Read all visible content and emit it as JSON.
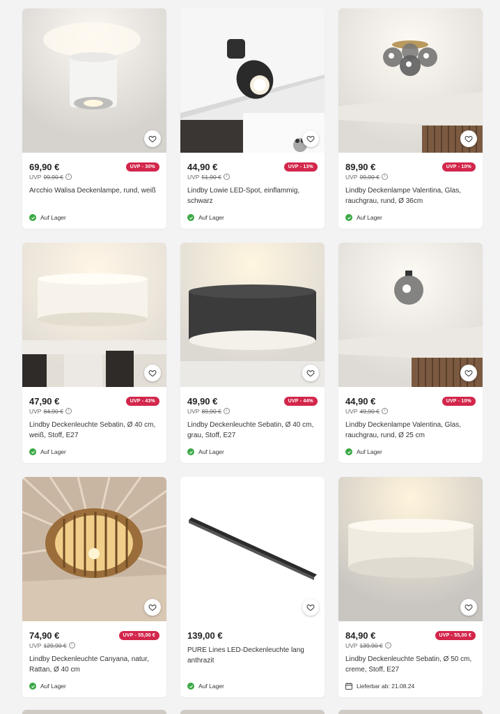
{
  "colors": {
    "accent": "#d3264b",
    "stock": "#3aa845",
    "background": "#f3f3f4"
  },
  "products": [
    {
      "price": "69,90 €",
      "uvp_label": "UVP",
      "uvp_price": "99,90 €",
      "badge": "UVP - 30%",
      "name": "Arcchio Walisa Deckenlampe, rund, weiß",
      "availability": "Auf Lager",
      "availability_icon": "check-circle-icon",
      "image": "white-cylinder-spot"
    },
    {
      "price": "44,90 €",
      "uvp_label": "UVP",
      "uvp_price": "51,90 €",
      "badge": "UVP - 13%",
      "name": "Lindby Lowie LED-Spot, einflammig, schwarz",
      "availability": "Auf Lager",
      "availability_icon": "check-circle-icon",
      "image": "black-spot"
    },
    {
      "price": "89,90 €",
      "uvp_label": "UVP",
      "uvp_price": "99,90 €",
      "badge": "UVP - 10%",
      "name": "Lindby Deckenlampe Valentina, Glas, rauchgrau, rund, Ø 36cm",
      "availability": "Auf Lager",
      "availability_icon": "check-circle-icon",
      "image": "glass-cluster"
    },
    {
      "price": "47,90 €",
      "uvp_label": "UVP",
      "uvp_price": "84,90 €",
      "badge": "UVP - 43%",
      "name": "Lindby Deckenleuchte Sebatin, Ø 40 cm, weiß, Stoff, E27",
      "availability": "Auf Lager",
      "availability_icon": "check-circle-icon",
      "image": "white-drum"
    },
    {
      "price": "49,90 €",
      "uvp_label": "UVP",
      "uvp_price": "89,90 €",
      "badge": "UVP - 44%",
      "name": "Lindby Deckenleuchte Sebatin, Ø 40 cm, grau, Stoff, E27",
      "availability": "Auf Lager",
      "availability_icon": "check-circle-icon",
      "image": "grey-drum"
    },
    {
      "price": "44,90 €",
      "uvp_label": "UVP",
      "uvp_price": "49,90 €",
      "badge": "UVP - 10%",
      "name": "Lindby Deckenlampe Valentina, Glas, rauchgrau, rund, Ø 25 cm",
      "availability": "Auf Lager",
      "availability_icon": "check-circle-icon",
      "image": "glass-single"
    },
    {
      "price": "74,90 €",
      "uvp_label": "UVP",
      "uvp_price": "129,90 €",
      "badge": "UVP - 55,00 €",
      "name": "Lindby Deckenleuchte Canyana, natur, Rattan, Ø 40 cm",
      "availability": "Auf Lager",
      "availability_icon": "check-circle-icon",
      "image": "rattan"
    },
    {
      "price": "139,00 €",
      "uvp_label": "",
      "uvp_price": "",
      "badge": "",
      "name": "PURE Lines LED-Deckenleuchte lang anthrazit",
      "availability": "Auf Lager",
      "availability_icon": "check-circle-icon",
      "image": "linear-bar"
    },
    {
      "price": "84,90 €",
      "uvp_label": "UVP",
      "uvp_price": "139,90 €",
      "badge": "UVP - 55,00 €",
      "name": "Lindby Deckenleuchte Sebatin, Ø 50 cm, creme, Stoff, E27",
      "availability": "Lieferbar ab: 21.08.24",
      "availability_icon": "calendar-icon",
      "image": "cream-drum"
    }
  ]
}
